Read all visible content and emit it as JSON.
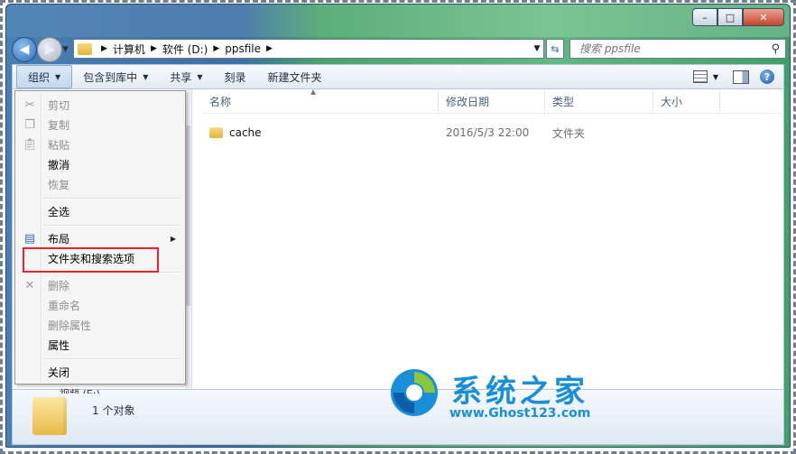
{
  "window": {
    "caption_buttons": {
      "minimize": "–",
      "maximize": "□",
      "close": "✕"
    }
  },
  "nav": {
    "back_icon": "back-arrow-icon",
    "forward_icon": "forward-arrow-icon",
    "breadcrumb": [
      "计算机",
      "软件 (D:)",
      "ppsfile"
    ],
    "search_placeholder": "搜索 ppsfile"
  },
  "toolbar": {
    "organize": "组织",
    "include_in_library": "包含到库中",
    "share": "共享",
    "burn": "刻录",
    "new_folder": "新建文件夹"
  },
  "columns": [
    "名称",
    "修改日期",
    "类型",
    "大小"
  ],
  "files": [
    {
      "name": "cache",
      "date": "2016/5/3 22:00",
      "type": "文件夹",
      "size": ""
    }
  ],
  "menu": {
    "items": [
      {
        "label": "剪切",
        "enabled": false,
        "icon": "scissors-icon"
      },
      {
        "label": "复制",
        "enabled": false,
        "icon": "copy-icon"
      },
      {
        "label": "粘贴",
        "enabled": false,
        "icon": "paste-icon"
      },
      {
        "label": "撤消",
        "enabled": true
      },
      {
        "label": "恢复",
        "enabled": false
      },
      {
        "label": "全选",
        "enabled": true
      },
      {
        "label": "布局",
        "enabled": true,
        "icon": "layout-icon",
        "submenu": true
      },
      {
        "label": "文件夹和搜索选项",
        "enabled": true,
        "highlighted": true
      },
      {
        "label": "删除",
        "enabled": false,
        "icon": "delete-x-icon"
      },
      {
        "label": "重命名",
        "enabled": false
      },
      {
        "label": "删除属性",
        "enabled": false
      },
      {
        "label": "属性",
        "enabled": true
      },
      {
        "label": "关闭",
        "enabled": true
      }
    ]
  },
  "navpane_peek": "视频 (E:)",
  "status": {
    "count_text": "1 个对象"
  },
  "watermark": {
    "name": "系统之家",
    "url": "www.Ghost123.com"
  },
  "colors": {
    "highlight_box": "#e8232a",
    "watermark": "#1a8fd8"
  }
}
